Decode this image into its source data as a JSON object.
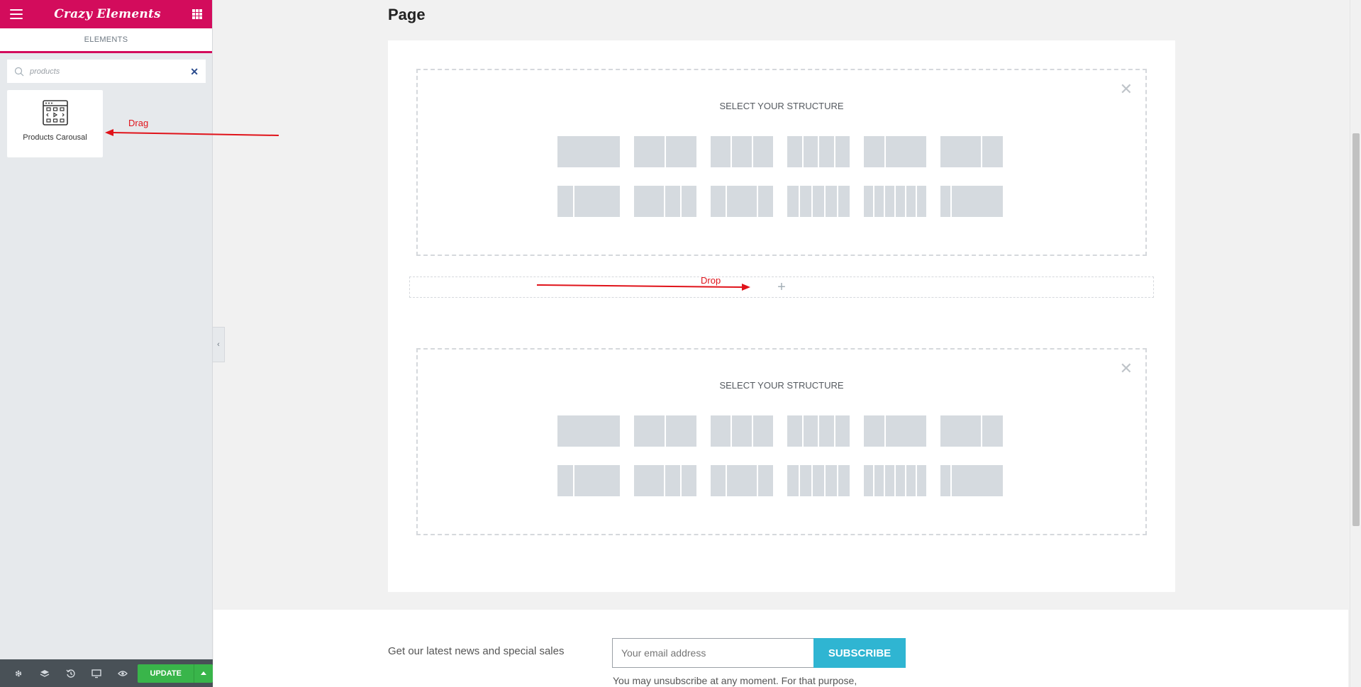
{
  "sidebar": {
    "logo": "Crazy Elements",
    "tab_label": "ELEMENTS",
    "search": {
      "value": "products"
    },
    "widget": {
      "label": "Products Carousal"
    },
    "footer": {
      "update_label": "UPDATE"
    }
  },
  "page": {
    "title": "Page",
    "structure_title_1": "SELECT YOUR STRUCTURE",
    "structure_title_2": "SELECT YOUR STRUCTURE"
  },
  "annotations": {
    "drag": "Drag",
    "drop": "Drop",
    "color": "#e0131a"
  },
  "footer": {
    "news_text": "Get our latest news and special sales",
    "email_placeholder": "Your email address",
    "subscribe_label": "SUBSCRIBE",
    "unsubscribe_text": "You may unsubscribe at any moment. For that purpose,"
  },
  "colors": {
    "brand": "#d30c5c",
    "update_green": "#39b54a",
    "subscribe_blue": "#2fb5d2"
  }
}
